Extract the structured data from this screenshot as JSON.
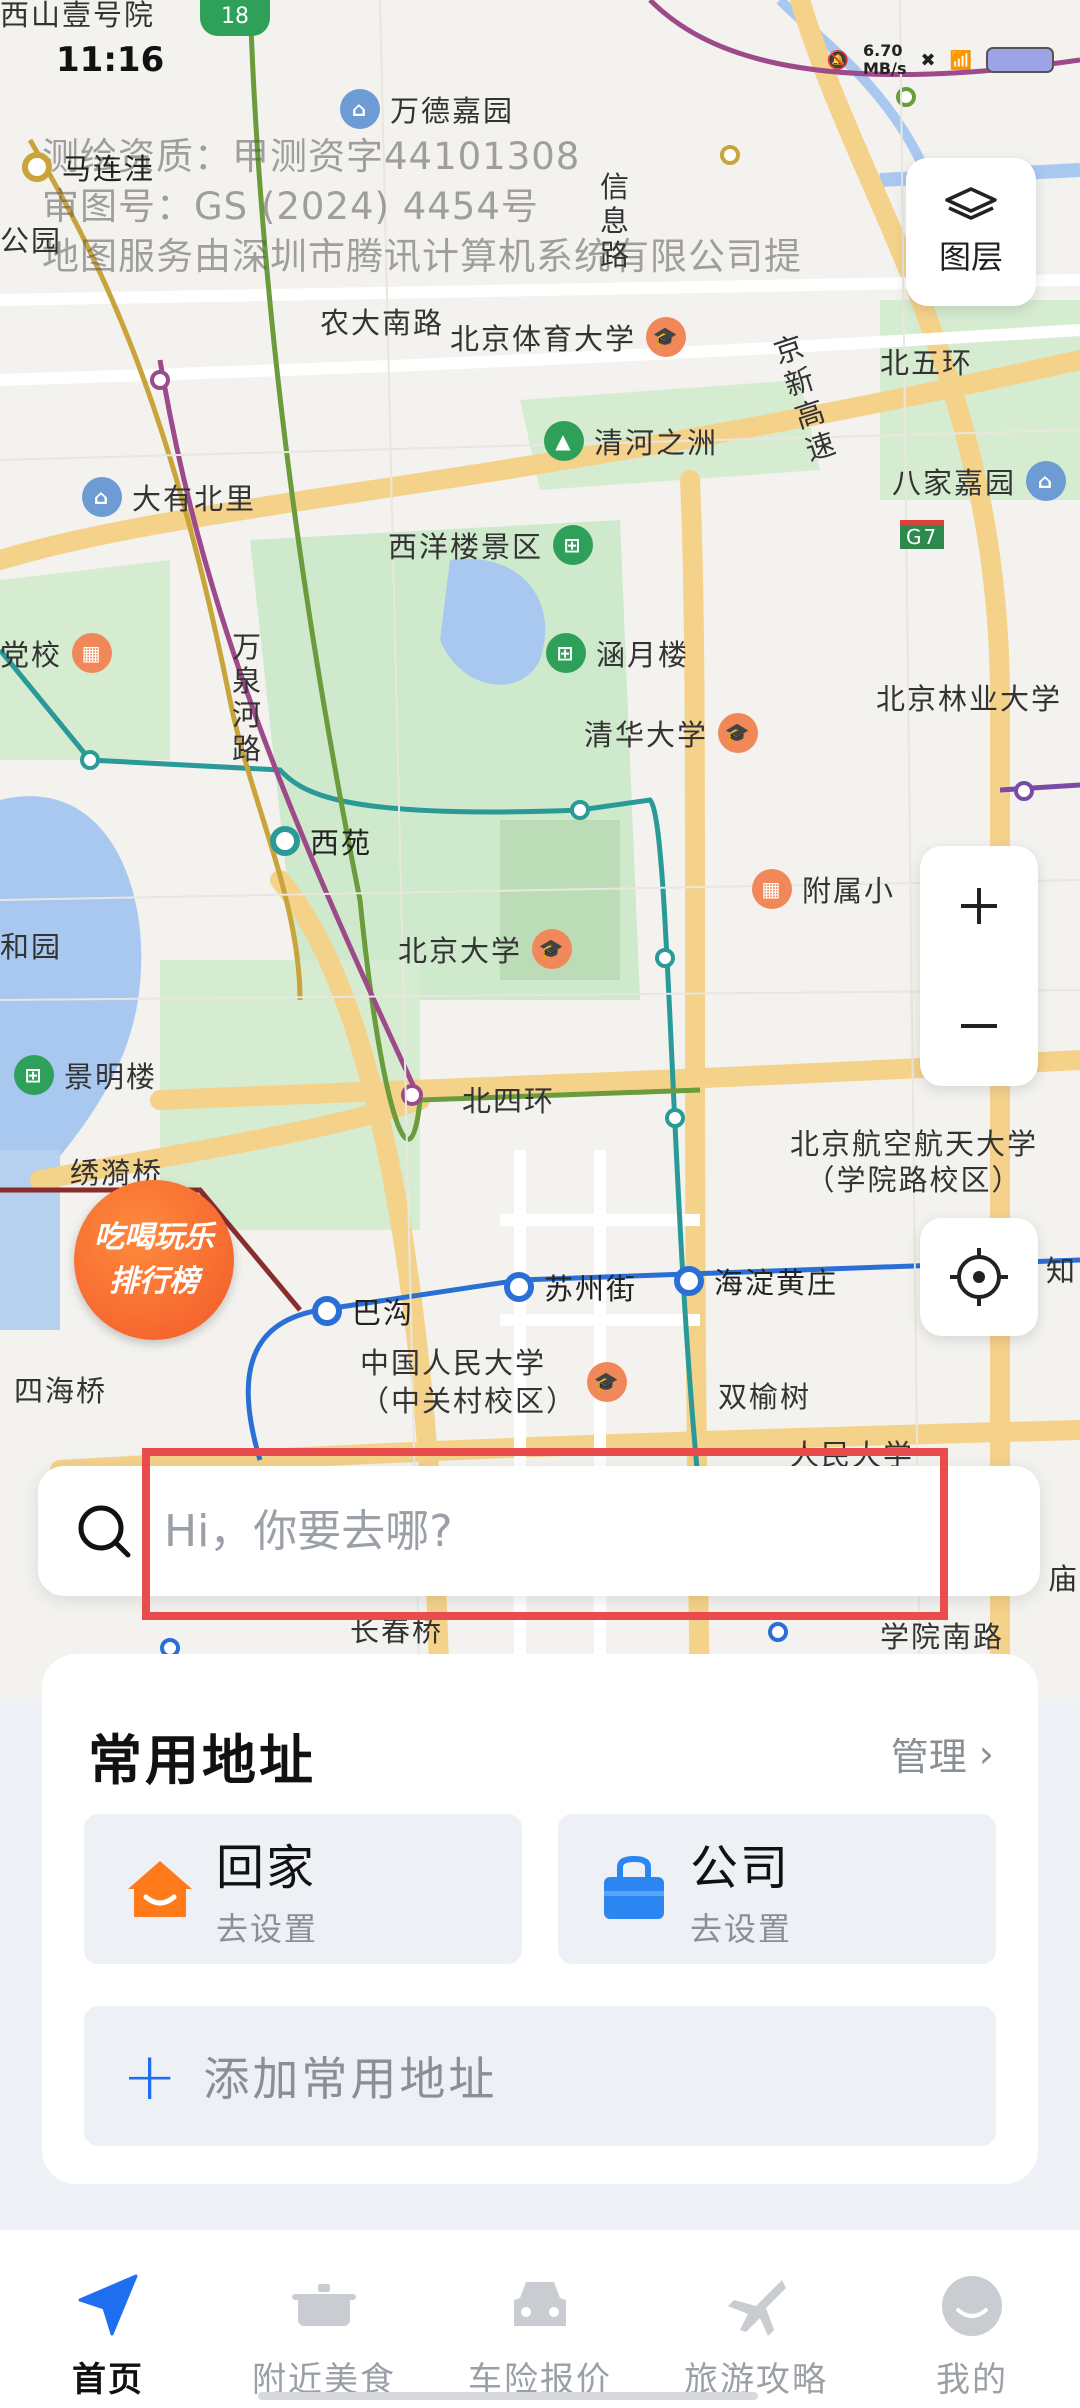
{
  "status": {
    "time": "11:16",
    "net_speed": "6.70\nMB/s"
  },
  "map": {
    "watermark_lines": [
      "测绘资质：甲测资字44101308",
      "审图号：GS (2024) 4454号",
      "地图服务由深圳市腾讯计算机系统有限公司提"
    ],
    "labels": {
      "top_clip": "西山壹号院",
      "road_badge": "18",
      "wandejiayuan": "万德嘉园",
      "majiapu": "马连洼",
      "gongfu": "公园",
      "xinlu": "信\n息\n路",
      "nongdanan": "农大南路",
      "bjtiyu": "北京体育大学",
      "jingxin": "京\n新\n高\n速",
      "beiwuhuan": "北五环",
      "qinghezhizhou": "清河之洲",
      "dayoubeili": "大有北里",
      "bajiajiayuan": "八家嘉园",
      "g7": "G7",
      "xiyanglou": "西洋楼景区",
      "dangxiao": "党校",
      "hanyuelou": "涵月楼",
      "wanquanhe": "万\n泉\n河\n路",
      "bjlinye": "北京林业大学",
      "qinghua": "清华大学",
      "xiyuan": "西苑",
      "fushuxiao": "附属小",
      "heyuan": "和园",
      "bjdaxue": "北京大学",
      "jingminglou": "景明楼",
      "beisihuan": "北四环",
      "xiuqiqiao": "绣漪桥",
      "bhang": "北京航空航天大学\n（学院路校区）",
      "suzhoujie": "苏州街",
      "haidianhuangzhuang": "海淀黄庄",
      "bagou": "巴沟",
      "renda": "中国人民大学\n（中关村校区）",
      "shuangyushu": "双榆树",
      "sihaiqiao": "四海桥",
      "renmindaxue": "人民大学",
      "changchunqiao": "长春桥",
      "xueyuannanlu": "学院南路",
      "miao": "庙",
      "zhi": "知"
    },
    "layers_label": "图层",
    "rank_badge": [
      "吃喝玩乐",
      "排行榜"
    ]
  },
  "search": {
    "placeholder": "Hi，你要去哪?"
  },
  "sheet": {
    "title": "常用地址",
    "manage": "管理",
    "home": {
      "label": "回家",
      "sub": "去设置"
    },
    "company": {
      "label": "公司",
      "sub": "去设置"
    },
    "add": "添加常用地址"
  },
  "tabs": [
    {
      "label": "首页",
      "active": true
    },
    {
      "label": "附近美食"
    },
    {
      "label": "车险报价"
    },
    {
      "label": "旅游攻略"
    },
    {
      "label": "我的"
    }
  ],
  "colors": {
    "accent": "#1f6ef0",
    "highlight": "#e84c4c",
    "green": "#2ea05a"
  }
}
